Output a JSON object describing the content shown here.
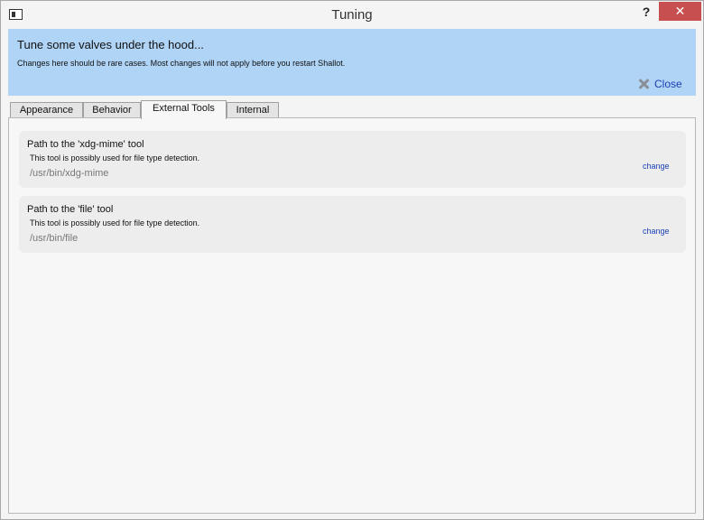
{
  "window": {
    "title": "Tuning",
    "help_label": "?",
    "close_glyph": "✕"
  },
  "banner": {
    "heading": "Tune some valves under the hood...",
    "subtext": "Changes here should be rare cases. Most changes will not apply before you restart Shallot.",
    "close_label": "Close",
    "background_color": "#b0d4f6"
  },
  "tabs": [
    {
      "label": "Appearance"
    },
    {
      "label": "Behavior"
    },
    {
      "label": "External Tools",
      "active": true
    },
    {
      "label": "Internal"
    }
  ],
  "settings": [
    {
      "title": "Path to the 'xdg-mime' tool",
      "description": "This tool is possibly used for file type detection.",
      "value": "/usr/bin/xdg-mime",
      "change_label": "change"
    },
    {
      "title": "Path to the 'file' tool",
      "description": "This tool is possibly used for file type detection.",
      "value": "/usr/bin/file",
      "change_label": "change"
    }
  ],
  "colors": {
    "link": "#1a3fb5",
    "close_button": "#c74f4f"
  }
}
